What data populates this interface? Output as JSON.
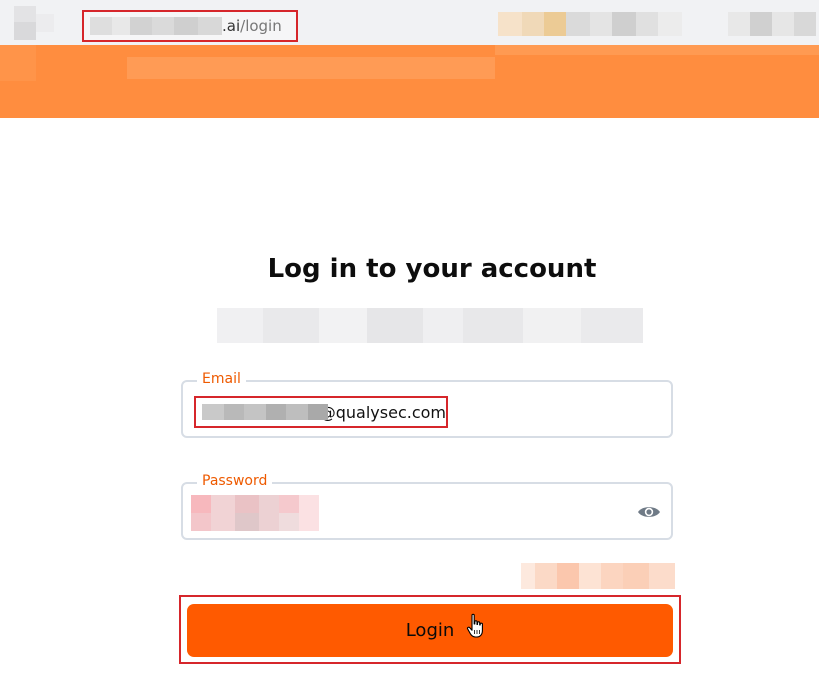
{
  "browser": {
    "url_host_suffix": ".ai",
    "url_path": "/login"
  },
  "login": {
    "title": "Log in to your account",
    "email_label": "Email",
    "email_value_suffix": "@qualysec.com",
    "password_label": "Password",
    "password_toggle_icon": "eye-icon",
    "submit_label": "Login",
    "cursor_icon": "hand-pointer-icon"
  },
  "colors": {
    "banner": "#ff8d3f",
    "accent": "#ff5a00",
    "label": "#ee5a00",
    "highlight_box": "#d6262b",
    "field_border": "#d7dde5"
  }
}
